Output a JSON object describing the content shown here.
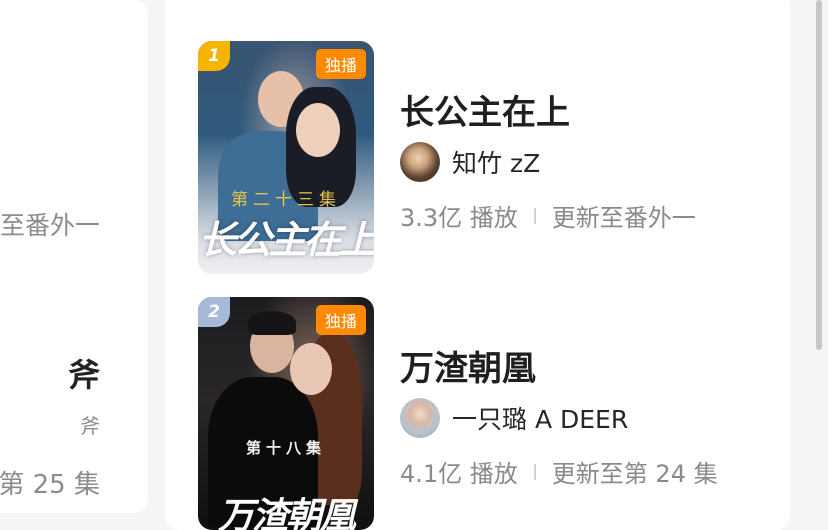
{
  "left_card": {
    "line1": "至番外一",
    "line2": "斧",
    "line3": "斧",
    "line4": "第 25 集"
  },
  "items": [
    {
      "rank": "1",
      "exclusive_label": "独播",
      "poster_subtitle": "第二十三集",
      "poster_title": "长公主在上",
      "title": "长公主在上",
      "author": "知竹 zZ",
      "plays": "3.3亿 播放",
      "update": "更新至番外一",
      "rank_color": "#f5b400",
      "tag_color": "#ff8a00"
    },
    {
      "rank": "2",
      "exclusive_label": "独播",
      "poster_subtitle": "第十八集",
      "poster_title": "万渣朝凰",
      "title": "万渣朝凰",
      "author": "一只璐 A DEER",
      "plays": "4.1亿 播放",
      "update": "更新至第 24 集",
      "rank_color": "#a7b9d9",
      "tag_color": "#ff8a00"
    }
  ]
}
